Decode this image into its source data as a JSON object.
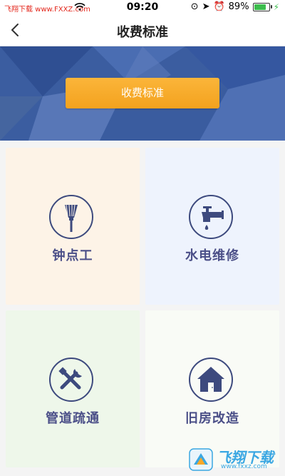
{
  "status_bar": {
    "carrier": "飞翔下载 www.FXXZ.com",
    "time": "09:20",
    "battery_percent": "89%",
    "battery_level": 0.89
  },
  "nav": {
    "title": "收费标准"
  },
  "banner": {
    "button_label": "收费标准"
  },
  "services": [
    {
      "label": "钟点工",
      "icon": "broom-icon",
      "bg": "#fdf3e7"
    },
    {
      "label": "水电维修",
      "icon": "faucet-icon",
      "bg": "#eef3fd"
    },
    {
      "label": "管道疏通",
      "icon": "tools-icon",
      "bg": "#eef7ea"
    },
    {
      "label": "旧房改造",
      "icon": "house-icon",
      "bg": "#f9fbf6"
    }
  ],
  "watermark": {
    "brand": "飞翔下载",
    "url": "www.fxxz.com"
  },
  "colors": {
    "accent_orange": "#f7a829",
    "icon_navy": "#3d4a7e",
    "label_purple": "#4b4f88",
    "banner_blue": "#3b5da0"
  }
}
